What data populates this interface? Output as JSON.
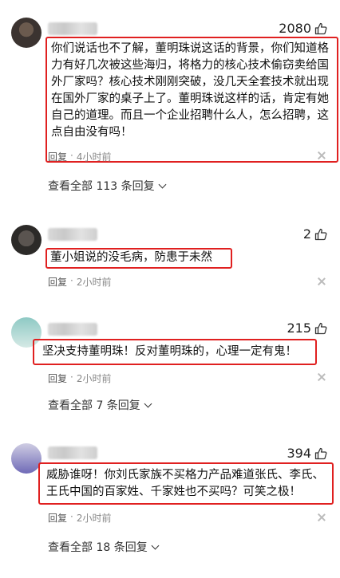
{
  "comments": [
    {
      "likes": "2080",
      "text": "你们说话也不了解，董明珠说这话的背景，你们知道格力有好几次被这些海归，将格力的核心技术偷窃卖给国外厂家吗？核心技术刚刚突破，没几天全套技术就出现在国外厂家的桌子上了。董明珠说这样的话，肯定有她自己的道理。而且一个企业招聘什么人，怎么招聘，这点自由没有吗！",
      "reply_label": "回复",
      "time": "4小时前",
      "view_all": "查看全部 113 条回复"
    },
    {
      "likes": "2",
      "text": "董小姐说的没毛病，防患于未然",
      "reply_label": "回复",
      "time": "2小时前"
    },
    {
      "likes": "215",
      "text": "坚决支持董明珠！反对董明珠的，心理一定有鬼！",
      "reply_label": "回复",
      "time": "2小时前",
      "view_all": "查看全部 7 条回复"
    },
    {
      "likes": "394",
      "text": "威胁谁呀！你刘氏家族不买格力产品难道张氏、李氏、王氏中国的百家姓、千家姓也不买吗？可笑之极！",
      "reply_label": "回复",
      "time": "2小时前",
      "view_all": "查看全部 18 条回复"
    }
  ],
  "separator": "·"
}
